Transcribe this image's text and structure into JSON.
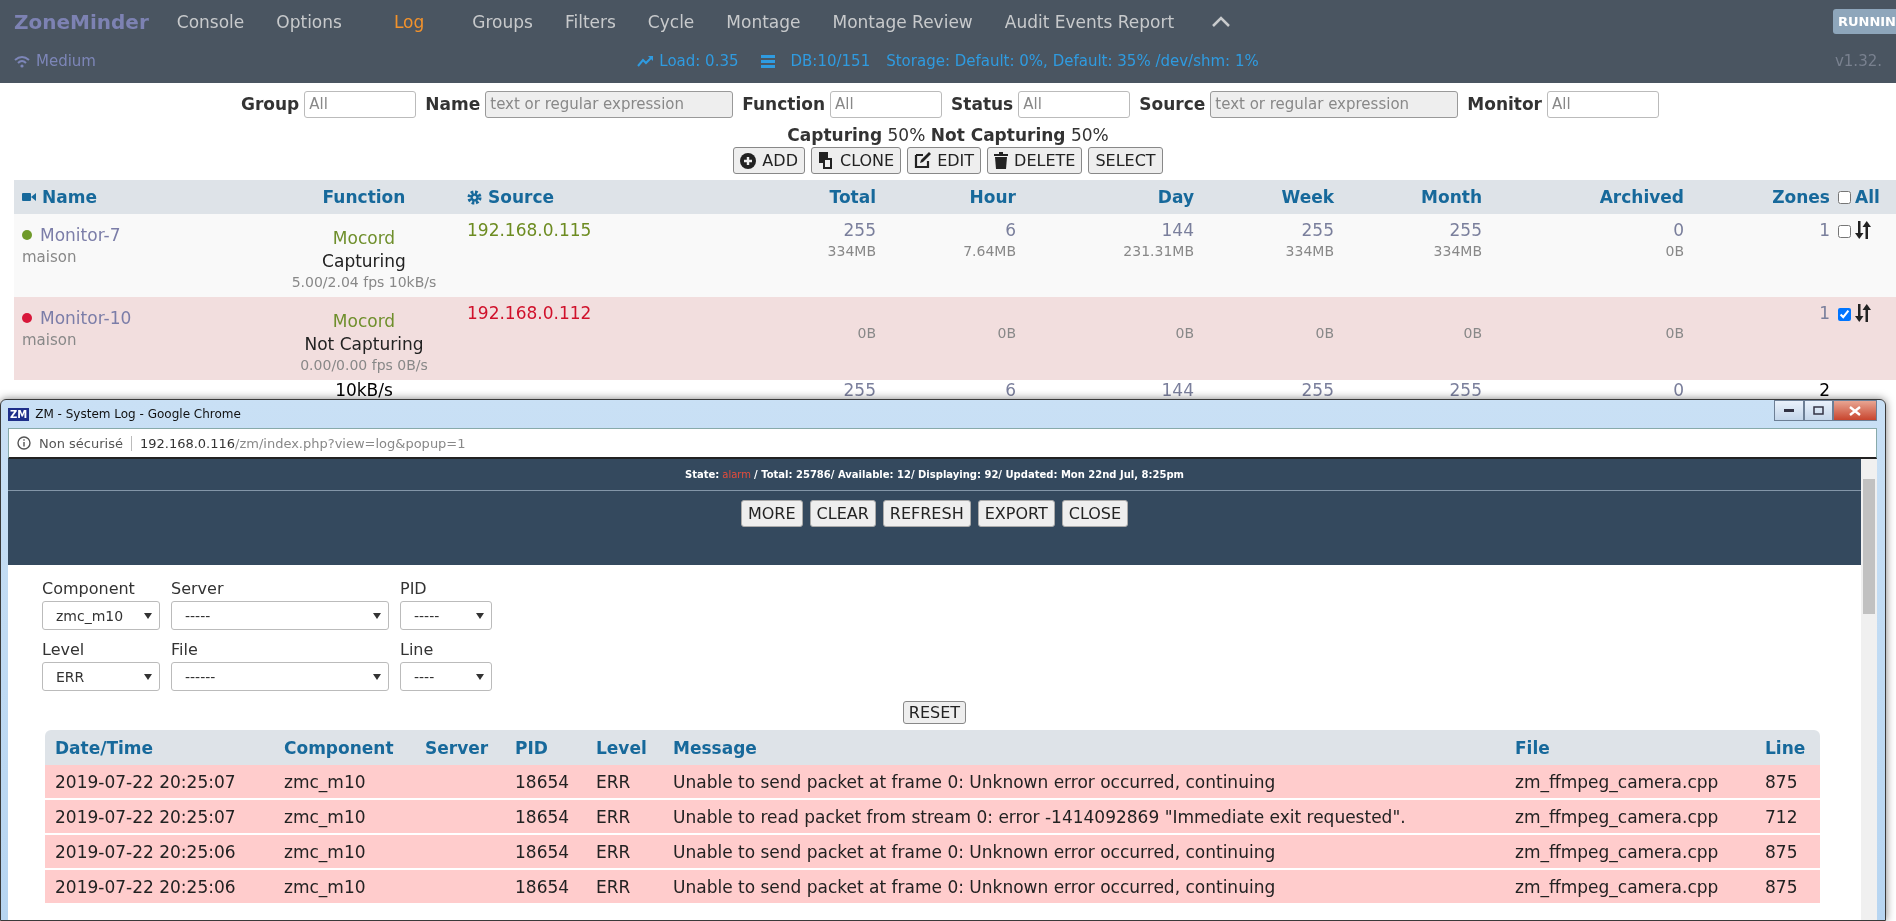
{
  "navbar": {
    "brand": "ZoneMinder",
    "items": [
      {
        "label": "Console",
        "selected": false
      },
      {
        "label": "Options",
        "selected": false
      },
      {
        "label": "Log",
        "selected": true
      },
      {
        "label": "Groups",
        "selected": false
      },
      {
        "label": "Filters",
        "selected": false
      },
      {
        "label": "Cycle",
        "selected": false
      },
      {
        "label": "Montage",
        "selected": false
      },
      {
        "label": "Montage Review",
        "selected": false
      },
      {
        "label": "Audit Events Report",
        "selected": false
      }
    ],
    "status_badge": "RUNNIN",
    "bandwidth": "Medium",
    "load": "Load: 0.35",
    "db": "DB:10/151",
    "storage": "Storage: Default: 0%, Default: 35% /dev/shm: 1%",
    "version": "v1.32."
  },
  "filters": [
    {
      "label": "Group",
      "placeholder": "All",
      "kind": "dropdown"
    },
    {
      "label": "Name",
      "placeholder": "text or regular expression",
      "kind": "text"
    },
    {
      "label": "Function",
      "placeholder": "All",
      "kind": "dropdown"
    },
    {
      "label": "Status",
      "placeholder": "All",
      "kind": "dropdown"
    },
    {
      "label": "Source",
      "placeholder": "text or regular expression",
      "kind": "text"
    },
    {
      "label": "Monitor",
      "placeholder": "All",
      "kind": "dropdown"
    }
  ],
  "summary": [
    {
      "label": "Capturing",
      "value": "50%"
    },
    {
      "label": "Not Capturing",
      "value": "50%"
    }
  ],
  "actions": [
    {
      "label": "ADD",
      "kind": "add"
    },
    {
      "label": "CLONE",
      "kind": "clone"
    },
    {
      "label": "EDIT",
      "kind": "edit"
    },
    {
      "label": "DELETE",
      "kind": "delete"
    },
    {
      "label": "SELECT",
      "kind": "select"
    }
  ],
  "monitors": {
    "columns": [
      "Name",
      "Function",
      "Source",
      "Total",
      "Hour",
      "Day",
      "Week",
      "Month",
      "Archived",
      "Zones",
      "All"
    ],
    "all_checked": false,
    "rows": [
      {
        "name": "Monitor-7",
        "group": "maison",
        "color": "#6f9a2a",
        "error": false,
        "function": "Mocord",
        "state": "Capturing",
        "fps": "5.00/2.04 fps 10kB/s",
        "source": "192.168.0.115",
        "stats": [
          {
            "count": "255",
            "size": "334MB"
          },
          {
            "count": "6",
            "size": "7.64MB"
          },
          {
            "count": "144",
            "size": "231.31MB"
          },
          {
            "count": "255",
            "size": "334MB"
          },
          {
            "count": "255",
            "size": "334MB"
          },
          {
            "count": "0",
            "size": "0B"
          }
        ],
        "zones": "1",
        "checked": false
      },
      {
        "name": "Monitor-10",
        "group": "maison",
        "color": "#d8173a",
        "error": true,
        "function": "Mocord",
        "state": "Not Capturing",
        "fps": "0.00/0.00 fps 0B/s",
        "source": "192.168.0.112",
        "stats": [
          {
            "size": "0B"
          },
          {
            "size": "0B"
          },
          {
            "size": "0B"
          },
          {
            "size": "0B"
          },
          {
            "size": "0B"
          },
          {
            "size": "0B"
          }
        ],
        "zones": "1",
        "checked": true
      }
    ],
    "partial_row": {
      "fps": "10kB/s",
      "counts": [
        "255",
        "6",
        "144",
        "255",
        "255",
        "0"
      ],
      "zones": "2"
    }
  },
  "popup": {
    "app_icon": "ZM",
    "title": "ZM - System Log - Google Chrome",
    "security": "Non sécurisé",
    "url_host": "192.168.0.116",
    "url_path": "/zm/index.php?view=log&popup=1",
    "status": {
      "label": "State:",
      "state": "alarm",
      "details": "/ Total: 25786/ Available: 12/ Displaying: 92/ Updated: Mon 22nd Jul, 8:25pm"
    },
    "buttons": [
      "MORE",
      "CLEAR",
      "REFRESH",
      "EXPORT",
      "CLOSE"
    ],
    "selectors": [
      {
        "label": "Component",
        "value": "zmc_m10"
      },
      {
        "label": "Server",
        "value": "-----"
      },
      {
        "label": "PID",
        "value": "-----"
      },
      {
        "label": "Level",
        "value": "ERR"
      },
      {
        "label": "File",
        "value": "------"
      },
      {
        "label": "Line",
        "value": "----"
      }
    ],
    "reset": "RESET",
    "log": {
      "columns": [
        "Date/Time",
        "Component",
        "Server",
        "PID",
        "Level",
        "Message",
        "File",
        "Line"
      ],
      "rows": [
        [
          "2019-07-22 20:25:07",
          "zmc_m10",
          "",
          "18654",
          "ERR",
          "Unable to send packet at frame 0: Unknown error occurred, continuing",
          "zm_ffmpeg_camera.cpp",
          "875"
        ],
        [
          "2019-07-22 20:25:07",
          "zmc_m10",
          "",
          "18654",
          "ERR",
          "Unable to read packet from stream 0: error -1414092869 \"Immediate exit requested\".",
          "zm_ffmpeg_camera.cpp",
          "712"
        ],
        [
          "2019-07-22 20:25:06",
          "zmc_m10",
          "",
          "18654",
          "ERR",
          "Unable to send packet at frame 0: Unknown error occurred, continuing",
          "zm_ffmpeg_camera.cpp",
          "875"
        ],
        [
          "2019-07-22 20:25:06",
          "zmc_m10",
          "",
          "18654",
          "ERR",
          "Unable to send packet at frame 0: Unknown error occurred, continuing",
          "zm_ffmpeg_camera.cpp",
          "875"
        ]
      ]
    }
  }
}
